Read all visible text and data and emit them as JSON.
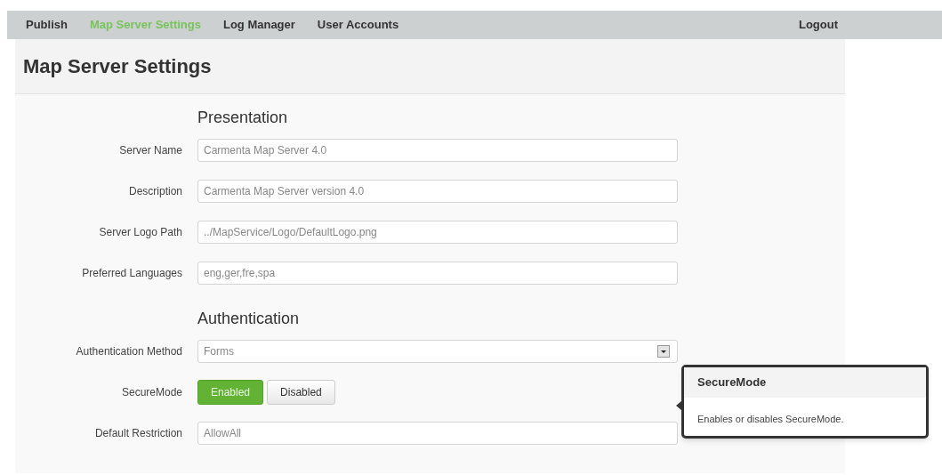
{
  "nav": {
    "items": [
      {
        "label": "Publish",
        "selected": false
      },
      {
        "label": "Map Server Settings",
        "selected": true
      },
      {
        "label": "Log Manager",
        "selected": false
      },
      {
        "label": "User Accounts",
        "selected": false
      }
    ],
    "logout": "Logout"
  },
  "page_title": "Map Server Settings",
  "sections": [
    {
      "heading": "Presentation",
      "fields": [
        {
          "kind": "text",
          "label": "Server Name",
          "value": "Carmenta Map Server 4.0"
        },
        {
          "kind": "text",
          "label": "Description",
          "value": "Carmenta Map Server version 4.0"
        },
        {
          "kind": "text",
          "label": "Server Logo Path",
          "value": "../MapService/Logo/DefaultLogo.png"
        },
        {
          "kind": "text",
          "label": "Preferred Languages",
          "value": "eng,ger,fre,spa"
        }
      ]
    },
    {
      "heading": "Authentication",
      "fields": [
        {
          "kind": "select",
          "label": "Authentication Method",
          "value": "Forms"
        },
        {
          "kind": "toggle",
          "label": "SecureMode",
          "options": [
            {
              "label": "Enabled",
              "selected": true
            },
            {
              "label": "Disabled",
              "selected": false
            }
          ]
        },
        {
          "kind": "text",
          "label": "Default Restriction",
          "value": "AllowAll"
        }
      ]
    }
  ],
  "tooltip": {
    "title": "SecureMode",
    "text": "Enables or disables SecureMode."
  }
}
